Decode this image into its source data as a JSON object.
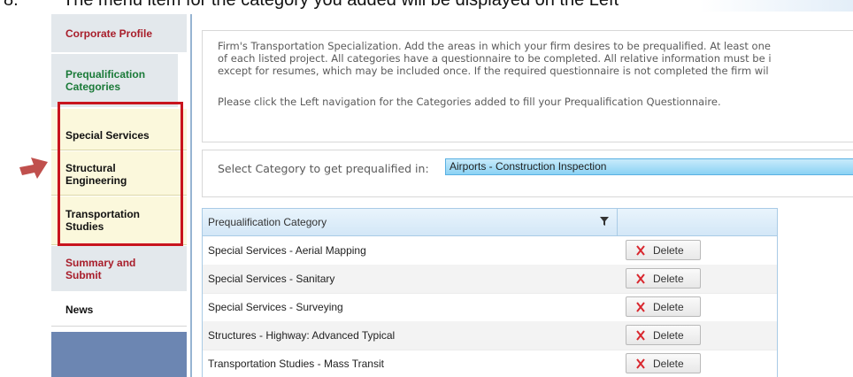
{
  "heading": {
    "number": "8.",
    "text": "The menu item for the category you added will be displayed on the Left"
  },
  "sidebar": {
    "items": [
      {
        "label": "Corporate Profile"
      },
      {
        "label": "Prequalification Categories"
      },
      {
        "label": "Special Services"
      },
      {
        "label": "Structural Engineering"
      },
      {
        "label": "Transportation Studies"
      },
      {
        "label": "Summary and Submit"
      },
      {
        "label": "News"
      }
    ]
  },
  "info": {
    "lines": [
      "Firm's Transportation Specialization. Add the areas in which your firm desires to be prequalified. At least one",
      "of each listed project. All categories have a questionnaire to be completed. All relative information must be i",
      "except for resumes, which may be included once. If the required questionnaire is not completed the firm wil"
    ],
    "note": "Please click the Left navigation for the Categories added to fill your Prequalification Questionnaire."
  },
  "select": {
    "label": "Select Category to get prequalified in:",
    "value": "Airports - Construction Inspection"
  },
  "grid": {
    "column": "Prequalification Category",
    "delete_label": "Delete",
    "rows": [
      {
        "category": "Special Services - Aerial Mapping"
      },
      {
        "category": "Special Services - Sanitary"
      },
      {
        "category": "Special Services - Surveying"
      },
      {
        "category": "Structures - Highway: Advanced Typical"
      },
      {
        "category": "Transportation Studies - Mass Transit"
      }
    ]
  },
  "colors": {
    "highlight": "#c8141e",
    "arrow": "#c0504d",
    "select_fill": "#8bd2f4",
    "nav_red": "#a81d2a",
    "nav_green": "#1a7a38"
  },
  "icons": {
    "filter": "filter-icon",
    "delete": "x-icon",
    "dropdown": "chevron-down-icon",
    "pointer": "arrow-right-icon"
  }
}
